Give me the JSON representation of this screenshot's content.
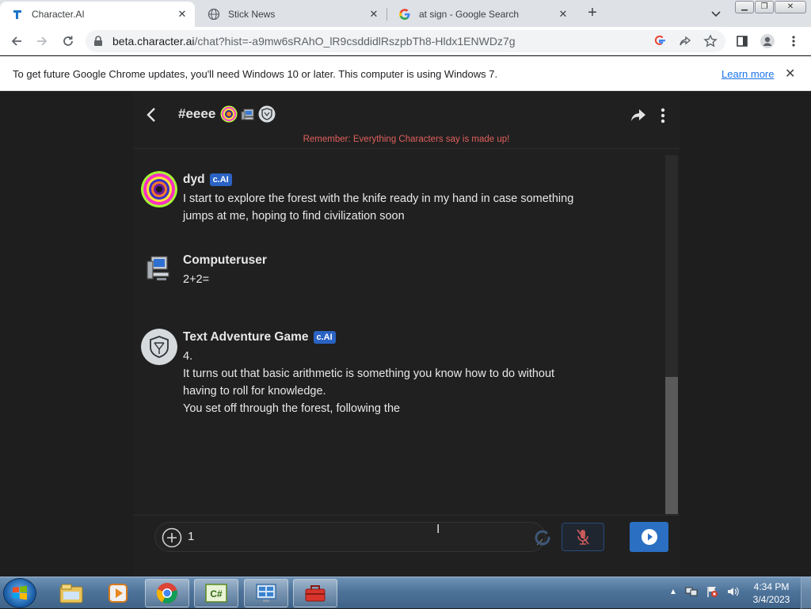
{
  "browser": {
    "tabs": [
      {
        "title": "Character.AI",
        "active": true
      },
      {
        "title": "Stick News",
        "active": false
      },
      {
        "title": "at sign - Google Search",
        "active": false
      }
    ],
    "url_host": "beta.character.ai",
    "url_path": "/chat?hist=-a9mw6sRAhO_lR9csddidlRszpbTh8-Hldx1ENWDz7g",
    "infobar": {
      "message": "To get future Google Chrome updates, you'll need Windows 10 or later. This computer is using Windows 7.",
      "link": "Learn more"
    }
  },
  "chat": {
    "room_name": "#eeee",
    "disclaimer": "Remember: Everything Characters say is made up!",
    "messages": [
      {
        "sender": "dyd",
        "badge": "c.AI",
        "lines": [
          "I start to explore the forest with the knife ready in my hand in case something jumps at me, hoping to find civilization soon"
        ]
      },
      {
        "sender": "Computeruser",
        "badge": "",
        "lines": [
          "2+2="
        ]
      },
      {
        "sender": "Text Adventure Game",
        "badge": "c.AI",
        "lines": [
          "4.",
          "It turns out that basic arithmetic is something you know how to do without having to roll for knowledge.",
          "You set off through the forest, following the"
        ]
      }
    ],
    "composer": {
      "value": "1"
    }
  },
  "taskbar": {
    "clock_time": "4:34 PM",
    "clock_date": "3/4/2023",
    "apps": [
      "explorer-icon",
      "media-player-icon",
      "chrome-icon",
      "csharp-icon",
      "control-panel-icon",
      "toolbox-icon"
    ]
  },
  "colors": {
    "accent": "#2a6fc2",
    "badge": "#2a63c4",
    "disclaimer": "#e0605c",
    "chat_bg": "#202020"
  }
}
